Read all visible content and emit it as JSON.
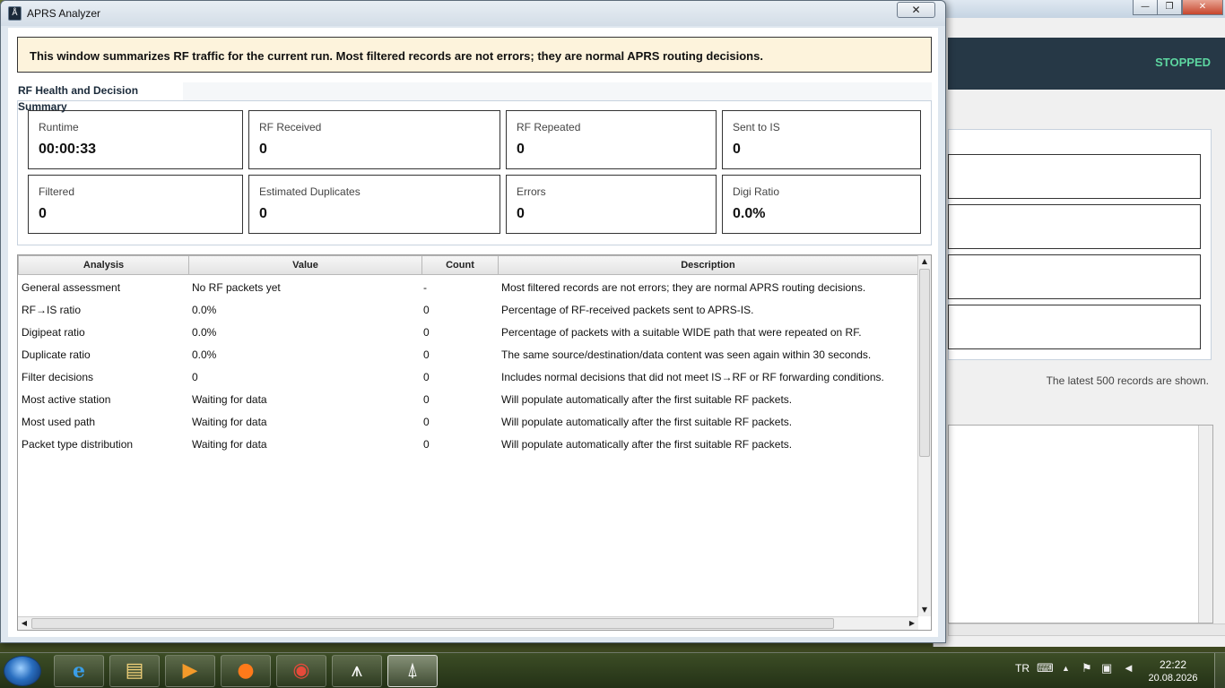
{
  "window": {
    "title": "APRS Analyzer",
    "close_glyph": "✕",
    "icon": "app-antenna-icon"
  },
  "banner": {
    "text": "This window summarizes RF traffic for the current run. Most filtered records are not errors; they are normal APRS routing decisions."
  },
  "summary": {
    "title": "RF Health and Decision Summary",
    "stats": [
      {
        "label": "Runtime",
        "value": "00:00:33"
      },
      {
        "label": "RF Received",
        "value": "0"
      },
      {
        "label": "RF Repeated",
        "value": "0"
      },
      {
        "label": "Sent to IS",
        "value": "0"
      },
      {
        "label": "Filtered",
        "value": "0"
      },
      {
        "label": "Estimated Duplicates",
        "value": "0"
      },
      {
        "label": "Errors",
        "value": "0"
      },
      {
        "label": "Digi Ratio",
        "value": "0.0%"
      }
    ]
  },
  "table": {
    "columns": [
      "Analysis",
      "Value",
      "Count",
      "Description"
    ],
    "rows": [
      {
        "analysis": "General assessment",
        "value": "No RF packets yet",
        "count": "-",
        "description": "Most filtered records are not errors; they are normal APRS routing decisions."
      },
      {
        "analysis": "RF→IS ratio",
        "value": "0.0%",
        "count": "0",
        "description": "Percentage of RF-received packets sent to APRS-IS."
      },
      {
        "analysis": "Digipeat ratio",
        "value": "0.0%",
        "count": "0",
        "description": "Percentage of packets with a suitable WIDE path that were repeated on RF."
      },
      {
        "analysis": "Duplicate ratio",
        "value": "0.0%",
        "count": "0",
        "description": "The same source/destination/data content was seen again within 30 seconds."
      },
      {
        "analysis": "Filter decisions",
        "value": "0",
        "count": "0",
        "description": "Includes normal decisions that did not meet IS→RF or RF forwarding conditions."
      },
      {
        "analysis": "Most active station",
        "value": "Waiting for data",
        "count": "0",
        "description": "Will populate automatically after the first suitable RF packets."
      },
      {
        "analysis": "Most used path",
        "value": "Waiting for data",
        "count": "0",
        "description": "Will populate automatically after the first suitable RF packets."
      },
      {
        "analysis": "Packet type distribution",
        "value": "Waiting for data",
        "count": "0",
        "description": "Will populate automatically after the first suitable RF packets."
      }
    ]
  },
  "background_app": {
    "status": "STOPPED",
    "status_color": "#5dd6a0",
    "records_note": "The latest 500 records are shown.",
    "minimize_glyph": "—",
    "maximize_glyph": "❐",
    "close_glyph": "✕"
  },
  "taskbar": {
    "apps": [
      {
        "name": "internet-explorer-icon",
        "glyph": "e"
      },
      {
        "name": "file-explorer-icon",
        "glyph": "▤"
      },
      {
        "name": "media-player-icon",
        "glyph": "▶"
      },
      {
        "name": "firefox-icon",
        "glyph": "●"
      },
      {
        "name": "chrome-icon",
        "glyph": "◉"
      },
      {
        "name": "aprs-tower-icon",
        "glyph": "⩚"
      },
      {
        "name": "aprs-analyzer-icon",
        "glyph": "⍋"
      }
    ],
    "language": "TR",
    "time": "22:22",
    "date": "20.08.2026"
  }
}
